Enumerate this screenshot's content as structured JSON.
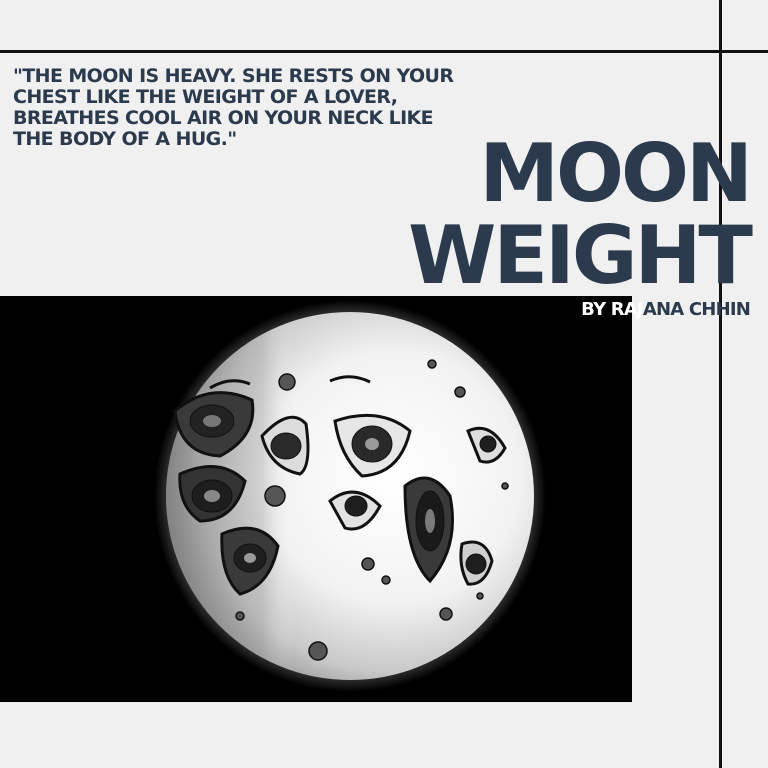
{
  "quote": {
    "line_1": "\"THE MOON IS HEAVY.  SHE RESTS ON YOUR",
    "line_2": "CHEST LIKE THE WEIGHT OF A LOVER,",
    "line_3": "BREATHES COOL AIR ON YOUR NECK LIKE",
    "line_4": "THE BODY OF A HUG.\""
  },
  "title": {
    "line_1": "MOON",
    "line_2": "WEIGHT"
  },
  "byline": {
    "part_on_dark": "BY RAJ",
    "part_on_light": "ANA CHHIN"
  },
  "colors": {
    "background": "#f0f0f0",
    "text_navy": "#2b3a4d",
    "rules": "#111111",
    "art_background": "#000000"
  },
  "artwork": {
    "subject": "moon-illustration"
  }
}
